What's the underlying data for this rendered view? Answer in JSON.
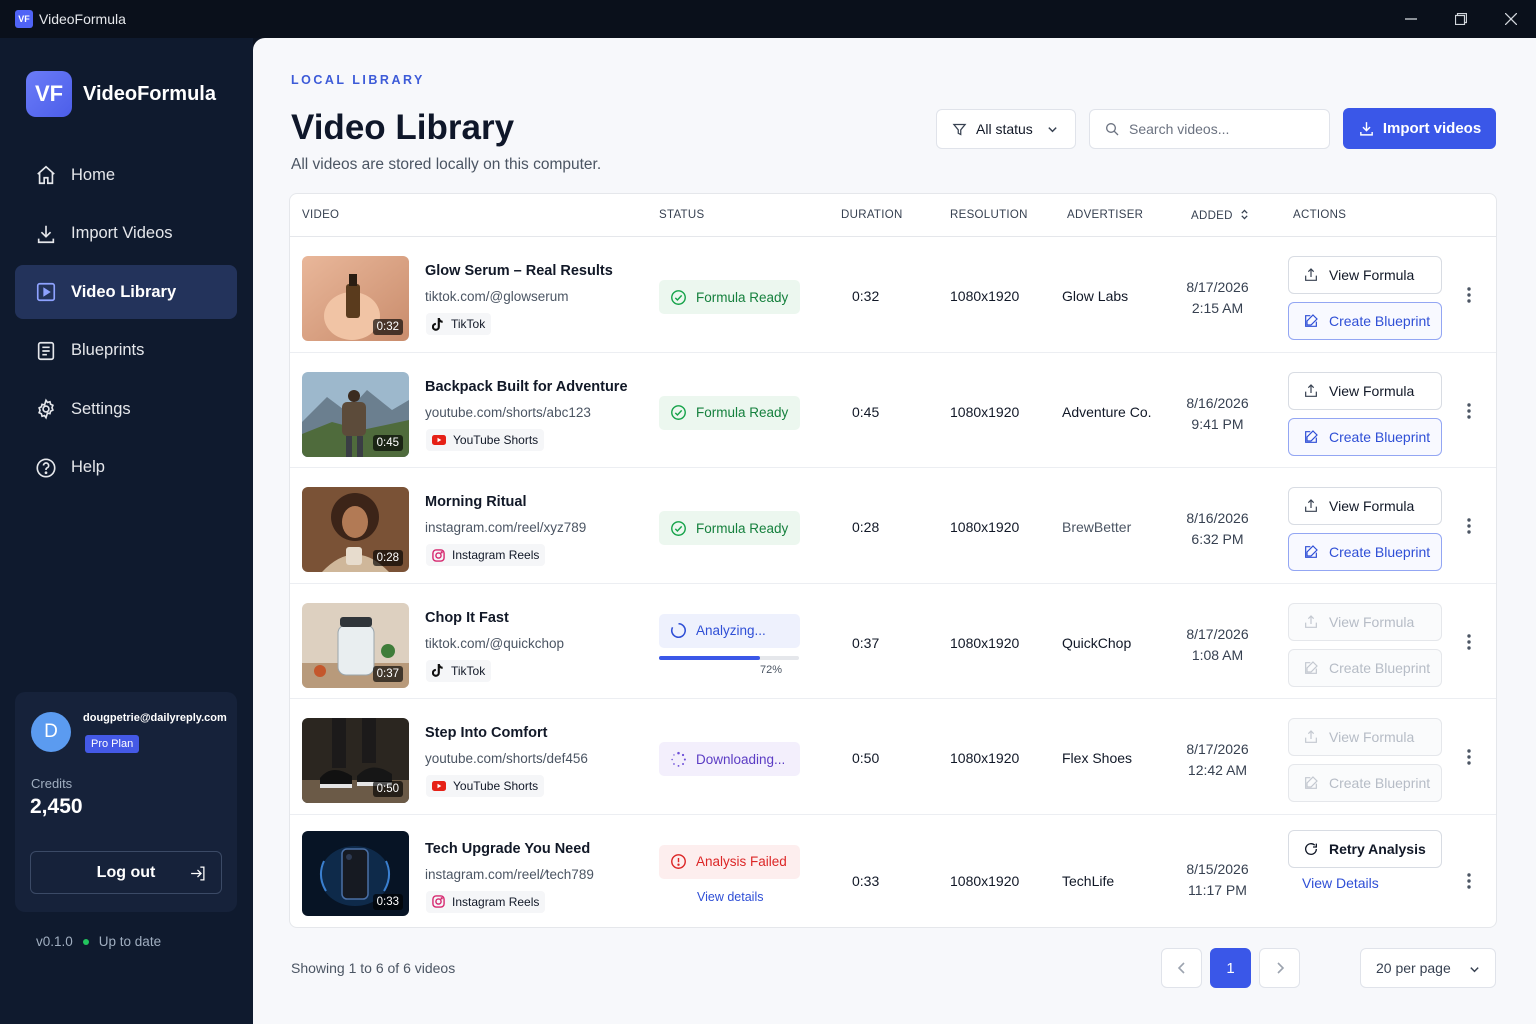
{
  "window": {
    "logo": "VF",
    "title": "VideoFormula"
  },
  "sidebar": {
    "logo": "VF",
    "brand": "VideoFormula",
    "items": [
      {
        "label": "Home",
        "icon": "home-icon"
      },
      {
        "label": "Import Videos",
        "icon": "download-icon"
      },
      {
        "label": "Video Library",
        "icon": "video-icon",
        "active": true
      },
      {
        "label": "Blueprints",
        "icon": "document-icon"
      },
      {
        "label": "Settings",
        "icon": "gear-icon"
      },
      {
        "label": "Help",
        "icon": "help-icon"
      }
    ],
    "account": {
      "initial": "D",
      "email": "dougpetrie@dailyreply.com",
      "plan": "Pro Plan",
      "credits_label": "Credits",
      "credits": "2,450",
      "logout": "Log out"
    },
    "version": "v0.1.0",
    "update_status": "Up to date"
  },
  "header": {
    "eyebrow": "LOCAL LIBRARY",
    "title": "Video Library",
    "subtitle": "All videos are stored locally on this computer.",
    "filter_label": "All status",
    "search_placeholder": "Search videos...",
    "import_label": "Import videos"
  },
  "table": {
    "columns": [
      "VIDEO",
      "STATUS",
      "DURATION",
      "RESOLUTION",
      "ADVERTISER",
      "ADDED",
      "ACTIONS"
    ],
    "rows": [
      {
        "title": "Glow Serum – Real Results",
        "url": "tiktok.com/@glowserum",
        "platform": "TikTok",
        "thumb_duration": "0:32",
        "status": "Formula Ready",
        "duration": "0:32",
        "resolution": "1080x1920",
        "advertiser": "Glow Labs",
        "added_date": "8/17/2026",
        "added_time": "2:15 AM",
        "action1": "View Formula",
        "action2": "Create Blueprint"
      },
      {
        "title": "Backpack Built for Adventure",
        "url": "youtube.com/shorts/abc123",
        "platform": "YouTube Shorts",
        "thumb_duration": "0:45",
        "status": "Formula Ready",
        "duration": "0:45",
        "resolution": "1080x1920",
        "advertiser": "Adventure Co.",
        "added_date": "8/16/2026",
        "added_time": "9:41 PM",
        "action1": "View Formula",
        "action2": "Create Blueprint"
      },
      {
        "title": "Morning Ritual",
        "url": "instagram.com/reel/xyz789",
        "platform": "Instagram Reels",
        "thumb_duration": "0:28",
        "status": "Formula Ready",
        "duration": "0:28",
        "resolution": "1080x1920",
        "advertiser": "BrewBetter",
        "added_date": "8/16/2026",
        "added_time": "6:32 PM",
        "action1": "View Formula",
        "action2": "Create Blueprint"
      },
      {
        "title": "Chop It Fast",
        "url": "tiktok.com/@quickchop",
        "platform": "TikTok",
        "thumb_duration": "0:37",
        "status": "Analyzing...",
        "progress": 0.72,
        "progress_label": "72%",
        "duration": "0:37",
        "resolution": "1080x1920",
        "advertiser": "QuickChop",
        "added_date": "8/17/2026",
        "added_time": "1:08 AM",
        "action1": "View Formula",
        "action2": "Create Blueprint"
      },
      {
        "title": "Step Into Comfort",
        "url": "youtube.com/shorts/def456",
        "platform": "YouTube Shorts",
        "thumb_duration": "0:50",
        "status": "Downloading...",
        "duration": "0:50",
        "resolution": "1080x1920",
        "advertiser": "Flex Shoes",
        "added_date": "8/17/2026",
        "added_time": "12:42 AM",
        "action1": "View Formula",
        "action2": "Create Blueprint"
      },
      {
        "title": "Tech Upgrade You Need",
        "url": "instagram.com/reel/⁄tech789",
        "platform": "Instagram Reels",
        "thumb_duration": "0:33",
        "status": "Analysis Failed",
        "status_link": "View details",
        "duration": "0:33",
        "resolution": "1080x1920",
        "advertiser": "TechLife",
        "added_date": "8/15/2026",
        "added_time": "11:17 PM",
        "action1": "Retry Analysis",
        "action2": "View Details"
      }
    ]
  },
  "footer": {
    "showing": "Showing 1 to 6 of 6 videos",
    "current_page": "1",
    "per_page": "20 per page"
  },
  "colors": {
    "accent": "#3a57e8",
    "success": "#15803d",
    "danger": "#dc2626",
    "sidebar_bg": "#0f1a2e"
  }
}
